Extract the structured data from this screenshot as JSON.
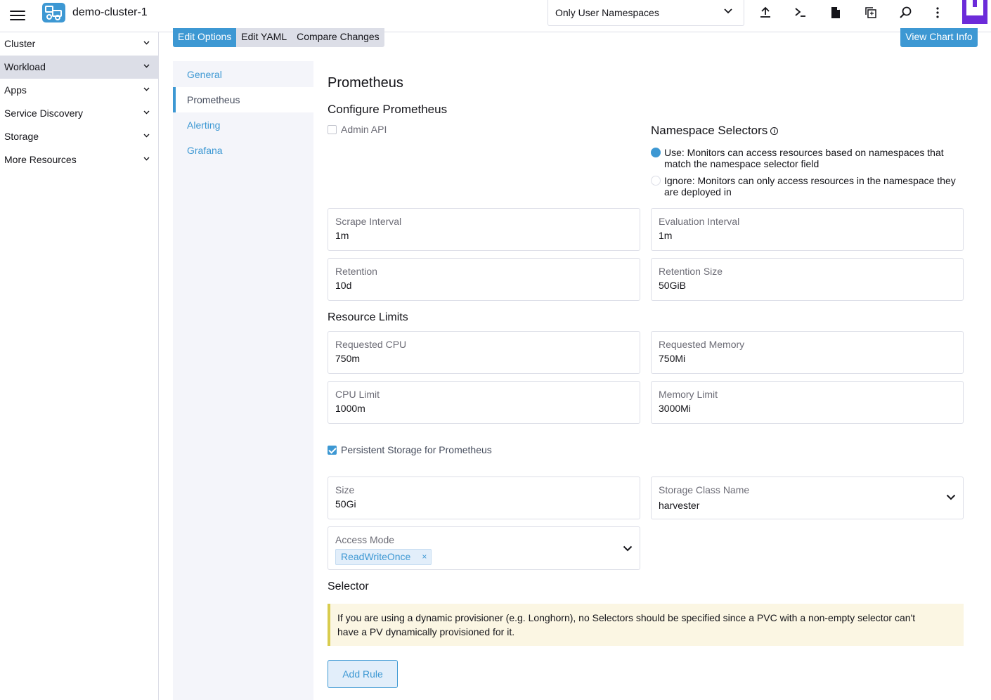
{
  "header": {
    "cluster_name": "demo-cluster-1",
    "namespace_filter": "Only User Namespaces"
  },
  "sidebar": {
    "items": [
      {
        "label": "Cluster"
      },
      {
        "label": "Workload"
      },
      {
        "label": "Apps"
      },
      {
        "label": "Service Discovery"
      },
      {
        "label": "Storage"
      },
      {
        "label": "More Resources"
      }
    ]
  },
  "top_tabs": [
    "Edit Options",
    "Edit YAML",
    "Compare Changes"
  ],
  "view_chart_info": "View Chart Info",
  "side_tabs": [
    "General",
    "Prometheus",
    "Alerting",
    "Grafana"
  ],
  "content": {
    "title": "Prometheus",
    "subtitle": "Configure Prometheus",
    "admin_api_label": "Admin API",
    "namespace_selectors_title": "Namespace Selectors",
    "radio_use": "Use: Monitors can access resources based on namespaces that match the namespace selector field",
    "radio_ignore": "Ignore: Monitors can only access resources in the namespace they are deployed in",
    "fields": {
      "scrape_interval": {
        "label": "Scrape Interval",
        "value": "1m"
      },
      "evaluation_interval": {
        "label": "Evaluation Interval",
        "value": "1m"
      },
      "retention": {
        "label": "Retention",
        "value": "10d"
      },
      "retention_size": {
        "label": "Retention Size",
        "value": "50GiB"
      },
      "requested_cpu": {
        "label": "Requested CPU",
        "value": "750m"
      },
      "requested_memory": {
        "label": "Requested Memory",
        "value": "750Mi"
      },
      "cpu_limit": {
        "label": "CPU Limit",
        "value": "1000m"
      },
      "memory_limit": {
        "label": "Memory Limit",
        "value": "3000Mi"
      },
      "size": {
        "label": "Size",
        "value": "50Gi"
      },
      "storage_class": {
        "label": "Storage Class Name",
        "value": "harvester"
      },
      "access_mode": {
        "label": "Access Mode",
        "value": "ReadWriteOnce"
      }
    },
    "resource_limits_title": "Resource Limits",
    "persistent_storage_label": "Persistent Storage for Prometheus",
    "selector_title": "Selector",
    "banner_text": "If you are using a dynamic provisioner (e.g. Longhorn), no Selectors should be specified since a PVC with a non-empty selector can't have a PV dynamically provisioned for it.",
    "add_rule": "Add Rule"
  }
}
